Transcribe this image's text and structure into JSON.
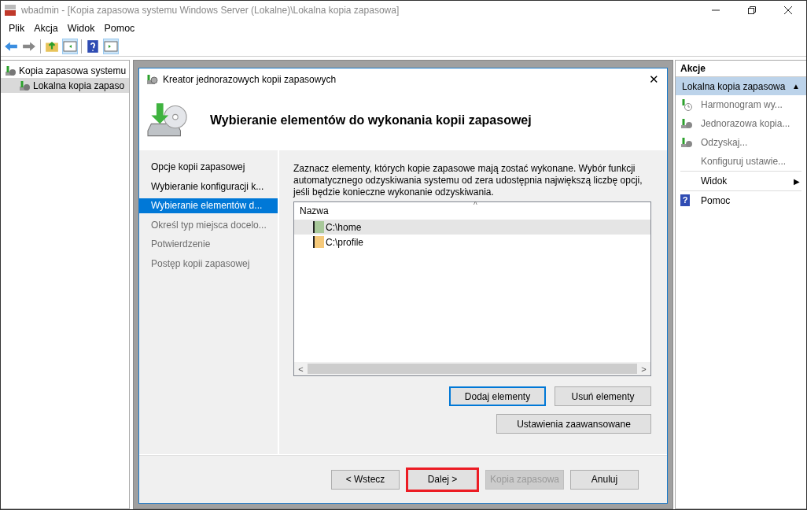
{
  "window": {
    "title": "wbadmin - [Kopia zapasowa systemu Windows Server (Lokalne)\\Lokalna kopia zapasowa]"
  },
  "menu": [
    "Plik",
    "Akcja",
    "Widok",
    "Pomoc"
  ],
  "tree": [
    {
      "label": "Kopia zapasowa systemu",
      "selected": false,
      "children": [
        {
          "label": "Lokalna kopia zapaso",
          "selected": true
        }
      ]
    }
  ],
  "dialog": {
    "title": "Kreator jednorazowych kopii zapasowych",
    "close": "✕",
    "heading": "Wybieranie elementów do wykonania kopii zapasowej",
    "steps": [
      {
        "label": "Opcje kopii zapasowej",
        "selected": false,
        "disabled": false
      },
      {
        "label": "Wybieranie konfiguracji k...",
        "selected": false,
        "disabled": false
      },
      {
        "label": "Wybieranie elementów d...",
        "selected": true,
        "disabled": false
      },
      {
        "label": "Określ typ miejsca docelo...",
        "selected": false,
        "disabled": true
      },
      {
        "label": "Potwierdzenie",
        "selected": false,
        "disabled": true
      },
      {
        "label": "Postęp kopii zapasowej",
        "selected": false,
        "disabled": true
      }
    ],
    "description": "Zaznacz elementy, których kopie zapasowe mają zostać wykonane. Wybór funkcji automatycznego odzyskiwania systemu od zera udostępnia największą liczbę opcji, jeśli będzie konieczne wykonanie odzyskiwania.",
    "list": {
      "column": "Nazwa",
      "sort_caret": "^",
      "rows": [
        {
          "label": "C:\\home",
          "selected": true,
          "color": "#a8c89a"
        },
        {
          "label": "C:\\profile",
          "selected": false,
          "color": "#f5c97a"
        }
      ],
      "scroll_left": "<",
      "scroll_right": ">"
    },
    "item_buttons": [
      {
        "label": "Dodaj elementy",
        "focused": true
      },
      {
        "label": "Usuń elementy",
        "focused": false
      }
    ],
    "advanced_button": "Ustawienia zaawansowane",
    "nav_buttons": [
      {
        "label": "< Wstecz",
        "disabled": false,
        "highlighted": false
      },
      {
        "label": "Dalej >",
        "disabled": false,
        "highlighted": true
      },
      {
        "label": "Kopia zapasowa",
        "disabled": true,
        "highlighted": false
      },
      {
        "label": "Anuluj",
        "disabled": false,
        "highlighted": false
      }
    ]
  },
  "actions": {
    "title": "Akcje",
    "section": "Lokalna kopia zapasowa",
    "section_caret": "▲",
    "items": [
      {
        "label": "Harmonogram wy...",
        "kind": "schedule",
        "disabled": true
      },
      {
        "label": "Jednorazowa kopia...",
        "kind": "backup",
        "disabled": true
      },
      {
        "label": "Odzyskaj...",
        "kind": "recover",
        "disabled": true
      },
      {
        "label": "Konfiguruj ustawie...",
        "kind": "plain",
        "disabled": true
      },
      {
        "label": "Widok",
        "kind": "submenu",
        "disabled": false,
        "arrow": "▶"
      },
      {
        "label": "Pomoc",
        "kind": "help",
        "disabled": false,
        "glyph": "?"
      }
    ]
  }
}
